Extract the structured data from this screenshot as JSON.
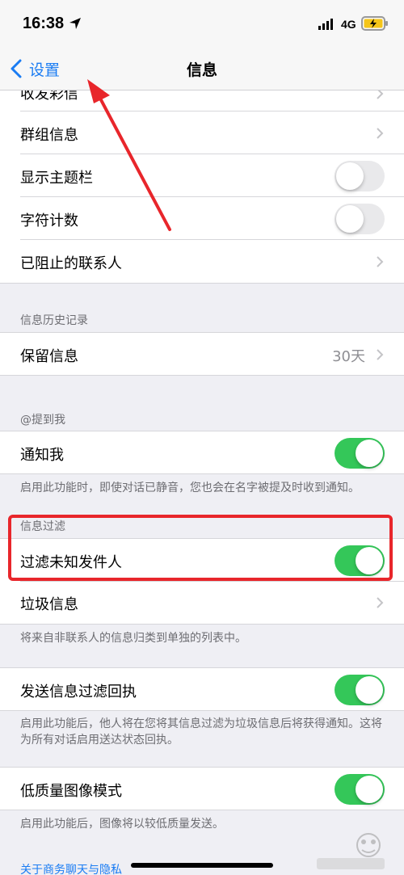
{
  "status": {
    "time": "16:38",
    "network": "4G"
  },
  "nav": {
    "back_label": "设置",
    "title": "信息"
  },
  "rows": {
    "mms_partial": "收发彩信",
    "group_messages": "群组信息",
    "show_subject": "显示主题栏",
    "char_count": "字符计数",
    "blocked": "已阻止的联系人",
    "keep_messages": "保留信息",
    "keep_value": "30天",
    "notify_me": "通知我",
    "filter_unknown": "过滤未知发件人",
    "junk": "垃圾信息",
    "send_filter_receipt": "发送信息过滤回执",
    "low_quality": "低质量图像模式"
  },
  "toggles": {
    "show_subject": false,
    "char_count": false,
    "notify_me": true,
    "filter_unknown": true,
    "send_filter_receipt": true,
    "low_quality": true
  },
  "sections": {
    "history": "信息历史记录",
    "mentions": "@提到我",
    "filtering": "信息过滤"
  },
  "notes": {
    "notify_me": "启用此功能时，即使对话已静音，您也会在名字被提及时收到通知。",
    "junk": "将来自非联系人的信息归类到单独的列表中。",
    "send_filter_receipt": "启用此功能后，他人将在您将其信息过滤为垃圾信息后将获得通知。这将为所有对话启用送达状态回执。",
    "low_quality": "启用此功能后，图像将以较低质量发送。"
  },
  "footer_link": "关于商务聊天与隐私",
  "colors": {
    "accent": "#1a7cf3",
    "toggle_on": "#34c759",
    "annotation": "#e8262b"
  }
}
